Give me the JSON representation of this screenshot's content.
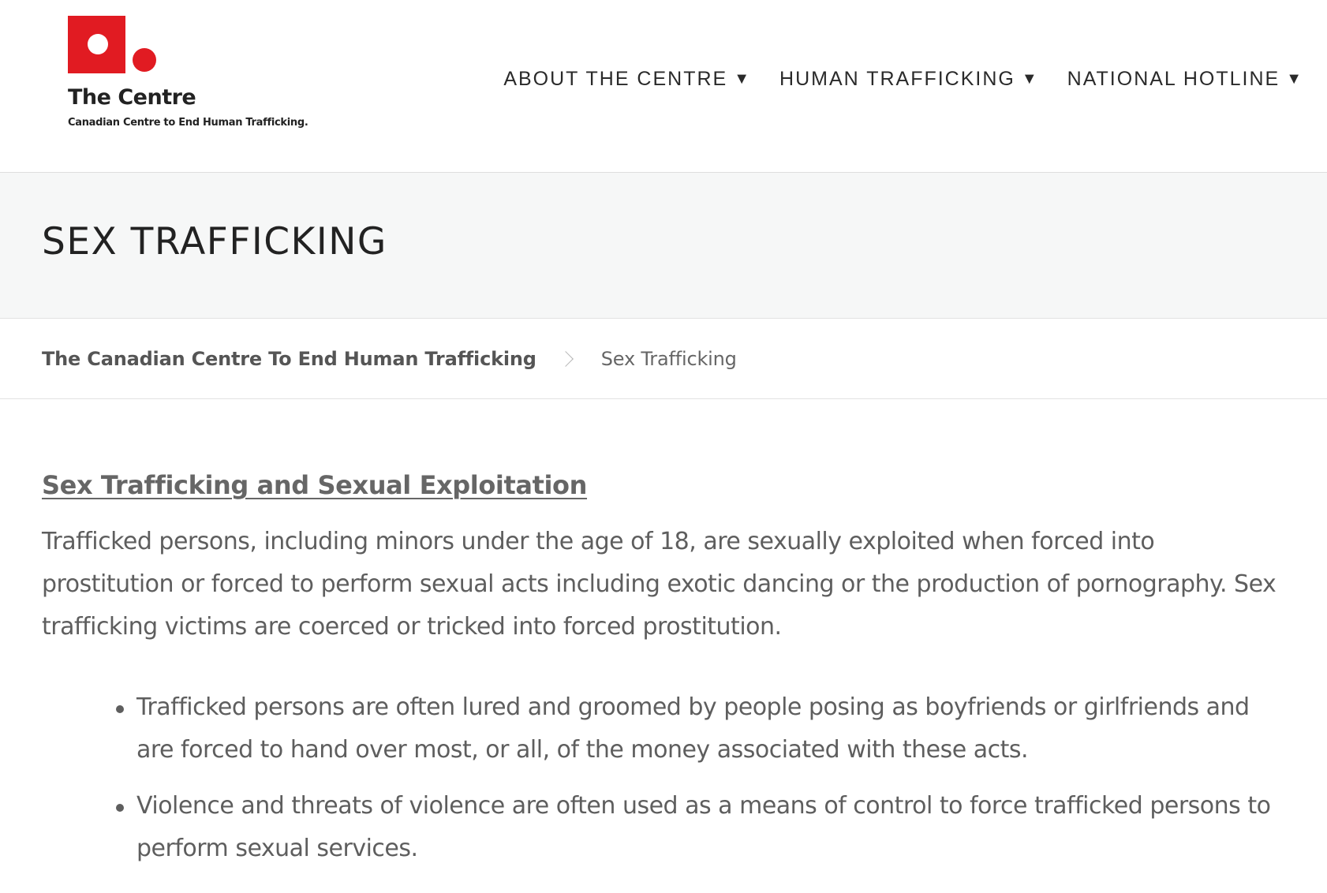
{
  "header": {
    "logo": {
      "name": "The Centre",
      "subtitle": "Canadian Centre to End Human Trafficking."
    },
    "nav": [
      {
        "label": "ABOUT THE CENTRE",
        "icon": "caret-down-icon"
      },
      {
        "label": "HUMAN TRAFFICKING",
        "icon": "caret-down-icon"
      },
      {
        "label": "NATIONAL HOTLINE",
        "icon": "caret-down-icon"
      }
    ],
    "brand_color": "#e11b22"
  },
  "page": {
    "title": "SEX TRAFFICKING"
  },
  "breadcrumb": {
    "home": "The Canadian Centre To End Human Trafficking",
    "separator_icon": "chevron-right-icon",
    "current": "Sex Trafficking"
  },
  "content": {
    "heading": "Sex Trafficking and Sexual Exploitation",
    "intro": "Trafficked persons, including minors under the age of 18, are sexually exploited when forced into prostitution or forced to perform sexual acts including exotic dancing or the production of pornography. Sex trafficking victims are coerced or tricked into forced prostitution.",
    "bullets": [
      "Trafficked persons are often lured and groomed by people posing as boyfriends or girlfriends and are forced to hand over most, or all, of the money associated with these acts.",
      "Violence and threats of violence are often used as a means of control to force trafficked persons to perform sexual services."
    ]
  }
}
